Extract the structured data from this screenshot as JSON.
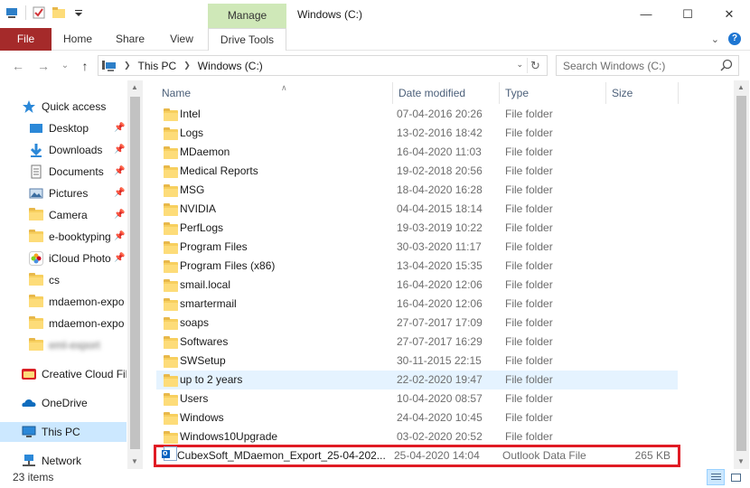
{
  "window": {
    "title": "Windows (C:)",
    "context_tab": "Manage",
    "controls": {
      "minimize": "—",
      "maximize": "☐",
      "close": "✕"
    }
  },
  "ribbon": {
    "tabs": [
      {
        "label": "File"
      },
      {
        "label": "Home"
      },
      {
        "label": "Share"
      },
      {
        "label": "View"
      },
      {
        "label": "Drive Tools"
      }
    ],
    "help": "?",
    "expand": "⌄"
  },
  "address": {
    "back": "←",
    "forward": "→",
    "recent": "⌄",
    "up": "↑",
    "crumbs": [
      "This PC",
      "Windows (C:)"
    ],
    "search_placeholder": "Search Windows (C:)"
  },
  "nav_pane": {
    "items": [
      {
        "label": "Quick access",
        "icon": "star-icon",
        "pinned": false
      },
      {
        "label": "Desktop",
        "icon": "desktop-icon",
        "pinned": true
      },
      {
        "label": "Downloads",
        "icon": "download-icon",
        "pinned": true
      },
      {
        "label": "Documents",
        "icon": "document-icon",
        "pinned": true
      },
      {
        "label": "Pictures",
        "icon": "pictures-icon",
        "pinned": true
      },
      {
        "label": "Camera",
        "icon": "folder-icon",
        "pinned": true
      },
      {
        "label": "e-booktyping",
        "icon": "folder-icon",
        "pinned": true
      },
      {
        "label": "iCloud Photo",
        "icon": "icloud-photos-icon",
        "pinned": true
      },
      {
        "label": "cs",
        "icon": "folder-icon",
        "pinned": false
      },
      {
        "label": "mdaemon-expo",
        "icon": "folder-icon",
        "pinned": false
      },
      {
        "label": "mdaemon-expo",
        "icon": "folder-icon",
        "pinned": false
      },
      {
        "label": "eml-export",
        "icon": "folder-icon",
        "pinned": false
      },
      {
        "label": "Creative Cloud Fil",
        "icon": "creative-cloud-icon",
        "pinned": false
      },
      {
        "label": "OneDrive",
        "icon": "onedrive-icon",
        "pinned": false
      },
      {
        "label": "This PC",
        "icon": "this-pc-icon",
        "pinned": false
      },
      {
        "label": "Network",
        "icon": "network-icon",
        "pinned": false
      }
    ]
  },
  "columns": {
    "name": "Name",
    "date": "Date modified",
    "type": "Type",
    "size": "Size"
  },
  "files": [
    {
      "name": "Intel",
      "date": "07-04-2016 20:26",
      "type": "File folder",
      "size": ""
    },
    {
      "name": "Logs",
      "date": "13-02-2016 18:42",
      "type": "File folder",
      "size": ""
    },
    {
      "name": "MDaemon",
      "date": "16-04-2020 11:03",
      "type": "File folder",
      "size": ""
    },
    {
      "name": "Medical Reports",
      "date": "19-02-2018 20:56",
      "type": "File folder",
      "size": ""
    },
    {
      "name": "MSG",
      "date": "18-04-2020 16:28",
      "type": "File folder",
      "size": ""
    },
    {
      "name": "NVIDIA",
      "date": "04-04-2015 18:14",
      "type": "File folder",
      "size": ""
    },
    {
      "name": "PerfLogs",
      "date": "19-03-2019 10:22",
      "type": "File folder",
      "size": ""
    },
    {
      "name": "Program Files",
      "date": "30-03-2020 11:17",
      "type": "File folder",
      "size": ""
    },
    {
      "name": "Program Files (x86)",
      "date": "13-04-2020 15:35",
      "type": "File folder",
      "size": ""
    },
    {
      "name": "smail.local",
      "date": "16-04-2020 12:06",
      "type": "File folder",
      "size": ""
    },
    {
      "name": "smartermail",
      "date": "16-04-2020 12:06",
      "type": "File folder",
      "size": ""
    },
    {
      "name": "soaps",
      "date": "27-07-2017 17:09",
      "type": "File folder",
      "size": ""
    },
    {
      "name": "Softwares",
      "date": "27-07-2017 16:29",
      "type": "File folder",
      "size": ""
    },
    {
      "name": "SWSetup",
      "date": "30-11-2015 22:15",
      "type": "File folder",
      "size": ""
    },
    {
      "name": "up to 2 years",
      "date": "22-02-2020 19:47",
      "type": "File folder",
      "size": ""
    },
    {
      "name": "Users",
      "date": "10-04-2020 08:57",
      "type": "File folder",
      "size": ""
    },
    {
      "name": "Windows",
      "date": "24-04-2020 10:45",
      "type": "File folder",
      "size": ""
    },
    {
      "name": "Windows10Upgrade",
      "date": "03-02-2020 20:52",
      "type": "File folder",
      "size": ""
    },
    {
      "name": "CubexSoft_MDaemon_Export_25-04-202...",
      "date": "25-04-2020 14:04",
      "type": "Outlook Data File",
      "size": "265 KB"
    }
  ],
  "status": {
    "count": "23 items"
  },
  "colors": {
    "file_tab": "#a52a2a",
    "manage_tab": "#cfe8b8",
    "selection": "#cce8ff",
    "highlight_box": "#e01b24"
  }
}
